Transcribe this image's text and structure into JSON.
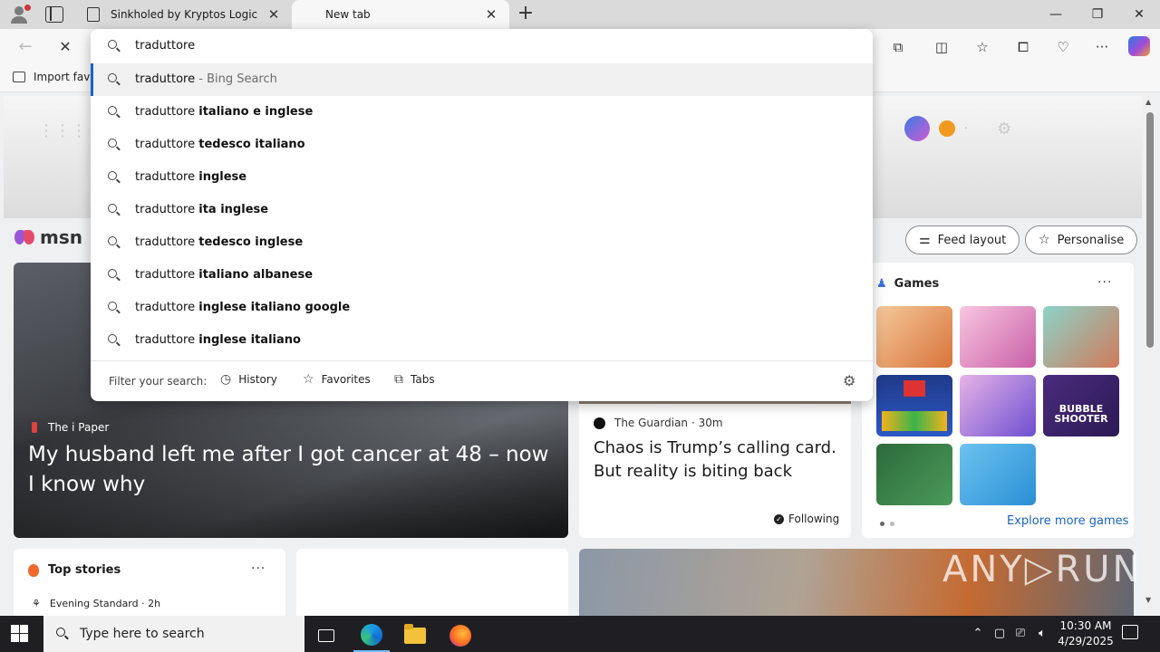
{
  "tabs": [
    {
      "label": "Sinkholed by Kryptos Logic",
      "close": "✕"
    },
    {
      "label": "New tab",
      "close": "✕"
    }
  ],
  "new_tab_symbol": "+",
  "window_controls": {
    "minimize": "—",
    "restore": "❐",
    "close": "✕"
  },
  "favorites_bar": {
    "import_label": "Import favo"
  },
  "omnibox": {
    "query": "traduttore",
    "suggestions": [
      {
        "prefix": "traduttore",
        "bold": "",
        "suffix": " - Bing Search"
      },
      {
        "prefix": "traduttore ",
        "bold": "italiano e inglese",
        "suffix": ""
      },
      {
        "prefix": "traduttore ",
        "bold": "tedesco italiano",
        "suffix": ""
      },
      {
        "prefix": "traduttore ",
        "bold": "inglese",
        "suffix": ""
      },
      {
        "prefix": "traduttore ",
        "bold": "ita inglese",
        "suffix": ""
      },
      {
        "prefix": "traduttore ",
        "bold": "tedesco inglese",
        "suffix": ""
      },
      {
        "prefix": "traduttore ",
        "bold": "italiano albanese",
        "suffix": ""
      },
      {
        "prefix": "traduttore ",
        "bold": "inglese italiano google",
        "suffix": ""
      },
      {
        "prefix": "traduttore ",
        "bold": "inglese italiano",
        "suffix": ""
      }
    ],
    "filter_label": "Filter your search:",
    "filters": {
      "history": "History",
      "favorites": "Favorites",
      "tabs": "Tabs"
    }
  },
  "msn": {
    "logo": "msn",
    "feed_layout": "Feed layout",
    "personalise": "Personalise",
    "hero": {
      "source": "The i Paper",
      "title": "My husband left me after I got cancer at 48 – now I know why"
    },
    "mid": {
      "source": "The Guardian",
      "time": "· 30m",
      "title": "Chaos is Trump’s calling card. But reality is biting back",
      "following": "Following"
    },
    "games": {
      "header": "Games",
      "more": "···",
      "explore": "Explore more games"
    },
    "top_stories": {
      "header": "Top stories",
      "more": "···",
      "source": "Evening Standard · 2h"
    }
  },
  "watermark": "ANY▷RUN",
  "taskbar": {
    "search_placeholder": "Type here to search",
    "time": "10:30 AM",
    "date": "4/29/2025"
  }
}
